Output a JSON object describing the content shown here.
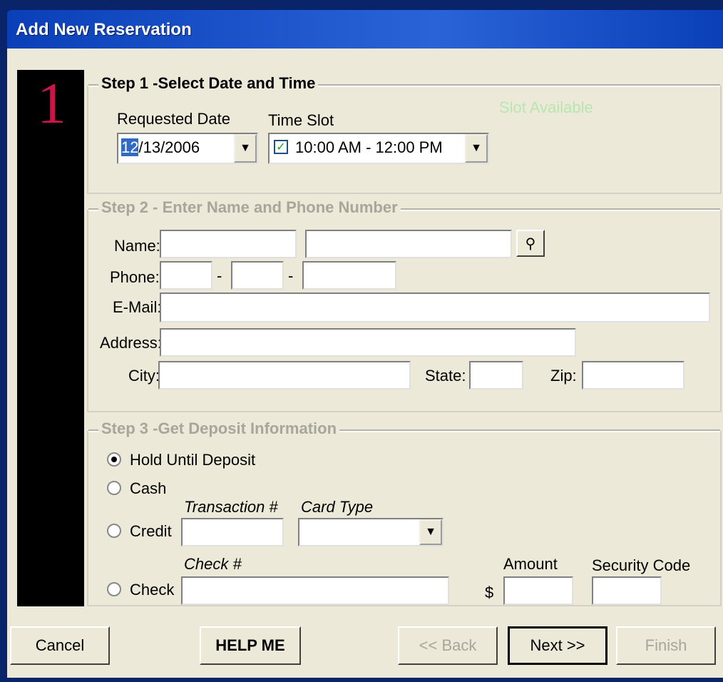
{
  "window": {
    "title": "Add New Reservation"
  },
  "step_number": "1",
  "step1": {
    "legend": "Step 1 -Select Date and Time",
    "requested_date_label": "Requested Date",
    "requested_date_selected": "12",
    "requested_date_rest": "/13/2006",
    "time_slot_label": "Time Slot",
    "time_slot_value": "10:00 AM - 12:00 PM",
    "slot_status": "Slot Available"
  },
  "step2": {
    "legend": "Step 2 - Enter Name and Phone Number",
    "name_label": "Name:",
    "phone_label": "Phone:",
    "phone_sep": "-",
    "email_label": "E-Mail:",
    "address_label": "Address:",
    "city_label": "City:",
    "state_label": "State:",
    "zip_label": "Zip:"
  },
  "step3": {
    "legend": "Step 3 -Get Deposit Information",
    "hold_label": "Hold Until Deposit",
    "cash_label": "Cash",
    "credit_label": "Credit",
    "check_label": "Check",
    "transaction_label": "Transaction #",
    "card_type_label": "Card Type",
    "check_num_label": "Check #",
    "amount_label": "Amount",
    "currency": "$",
    "security_code_label": "Security Code"
  },
  "buttons": {
    "cancel": "Cancel",
    "help": "HELP ME",
    "back": "<< Back",
    "next": "Next >>",
    "finish": "Finish"
  },
  "colors": {
    "slot_status": "#b7e6b0",
    "step_number": "#c8164a"
  }
}
